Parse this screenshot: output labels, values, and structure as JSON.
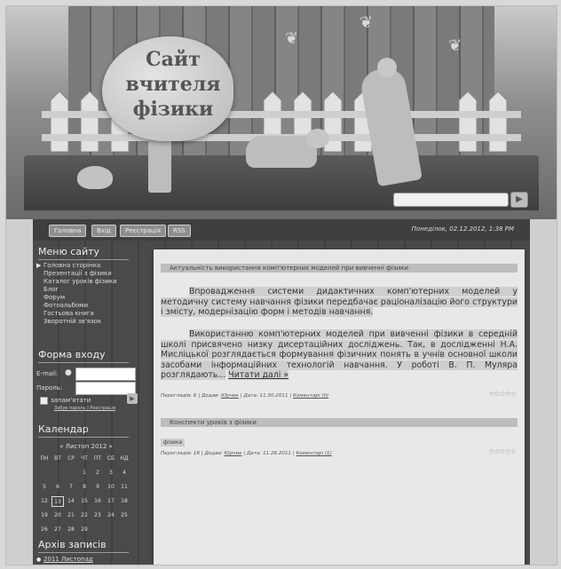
{
  "site": {
    "title_line1": "Сайт",
    "title_line2": "вчителя",
    "title_line3": "фізики"
  },
  "nav": {
    "items": [
      "Головна",
      "Вхід",
      "Реєстрація",
      "RSS"
    ],
    "date": "Понеділок, 02.12.2012, 1:38 PM"
  },
  "sidebar": {
    "menu_title": "Меню сайту",
    "menu_items": [
      "Головна сторінка",
      "Презентації з фізики",
      "Каталог уроків фізики",
      "Блог",
      "Форум",
      "Фотоальбоми",
      "Гостьова книга",
      "Зворотній зв'язок"
    ],
    "login_title": "Форма входу",
    "email_label": "E-mail:",
    "password_label": "Пароль:",
    "remember_label": "запам'ятати",
    "links_text": "Забув пароль | Реєстрація",
    "calendar_title": "Календар",
    "calendar_month": "« Листоп 2012 »",
    "weekdays": [
      "ПН",
      "ВТ",
      "СР",
      "ЧТ",
      "ПТ",
      "СБ",
      "НД"
    ],
    "calendar_rows": [
      [
        "",
        "",
        "",
        "1",
        "2",
        "3",
        "4"
      ],
      [
        "5",
        "6",
        "7",
        "8",
        "9",
        "10",
        "11"
      ],
      [
        "12",
        "13",
        "14",
        "15",
        "16",
        "17",
        "18"
      ],
      [
        "19",
        "20",
        "21",
        "22",
        "23",
        "24",
        "25"
      ],
      [
        "26",
        "27",
        "28",
        "29",
        "",
        "",
        ""
      ]
    ],
    "archive_title": "Архів записів",
    "archive_item": "2011 Листопад"
  },
  "posts": [
    {
      "title": "Актуальність використання комп'ютерних моделей при вивченні фізики",
      "paragraph1": "Впровадження системи дидактичних комп'ютерних моделей у методичну систему навчання фізики передбачає раціоналізацію його структури і змісту, модернізацію форм і методів навчання.",
      "paragraph2": "Використанню комп'ютерних моделей при вивченні фізики в середній школі присвячено низку дисертаційних досліджень. Так, в дослідженні Н.А. Мисліцької розглядається формування фізичних понять в учнів основної школи засобами інформаційних технологій навчання. У роботі В. П. Муляра розглядають...",
      "read_more": "Читати далі »",
      "meta_views": "Переглядів: 6",
      "meta_added": "Додав:",
      "meta_author": "Юрчик",
      "meta_date": "Дата: 11.30.2011",
      "meta_comments": "Коментарі (0)",
      "stars": "☆☆☆☆☆"
    },
    {
      "title": "Конспекти уроків з фізики",
      "tag": "фізика",
      "meta_views": "Переглядів: 16",
      "meta_added": "Додав:",
      "meta_author": "Юрчик",
      "meta_date": "Дата: 11.26.2011",
      "meta_comments": "Коментарі (1)",
      "stars": "☆☆☆☆☆"
    }
  ]
}
